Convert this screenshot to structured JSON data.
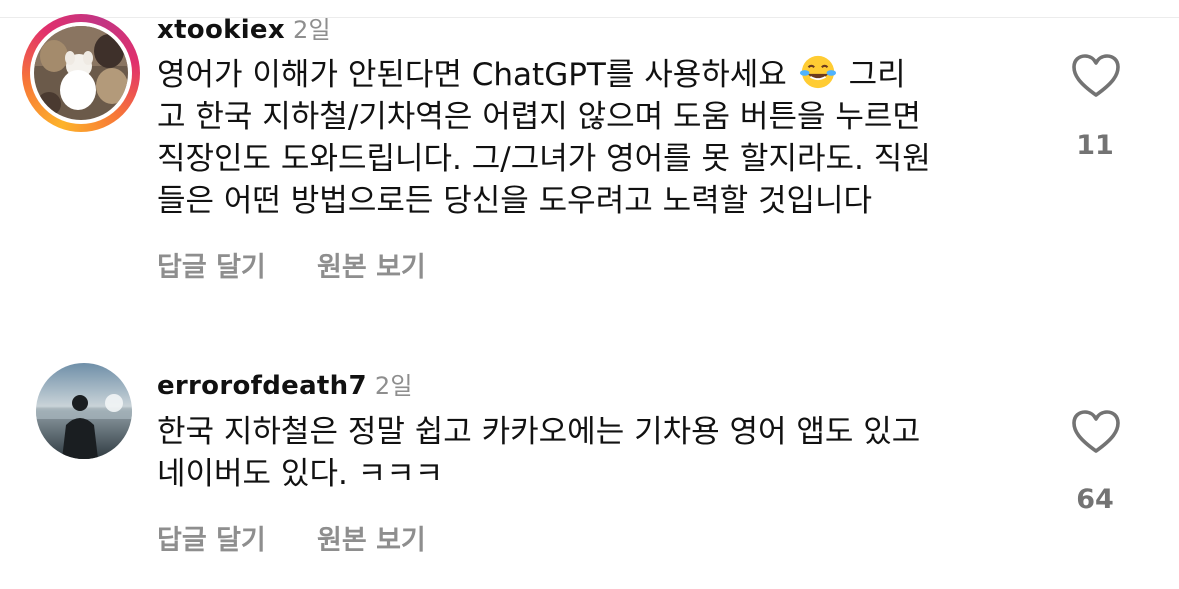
{
  "comments": [
    {
      "username": "xtookiex",
      "time": "2일",
      "text_before_emoji": "영어가 이해가 안된다면 ChatGPT를 사용하세요",
      "emoji": "face-with-tears-of-joy",
      "text_after_emoji": "그리",
      "text_lines": [
        "고 한국 지하철/기차역은 어렵지 않으며 도움 버튼을 누르면",
        "직장인도 도와드립니다. 그/그녀가 영어를 못 할지라도. 직원",
        "들은 어떤 방법으로든 당신을 도우려고 노력할 것입니다"
      ],
      "reply_label": "답글 달기",
      "original_label": "원본 보기",
      "like_count": "11"
    },
    {
      "username": "errorofdeath7",
      "time": "2일",
      "text_lines": [
        "한국 지하철은 정말 쉽고 카카오에는 기차용 영어 앱도 있고",
        "네이버도 있다. ㅋㅋㅋ"
      ],
      "reply_label": "답글 달기",
      "original_label": "원본 보기",
      "like_count": "64"
    }
  ],
  "colors": {
    "muted": "#8e8e8e",
    "text": "#111111",
    "story_ring": [
      "#fdb32a",
      "#e1306c",
      "#c13584"
    ]
  },
  "icons": {
    "like": "heart-outline-icon"
  }
}
